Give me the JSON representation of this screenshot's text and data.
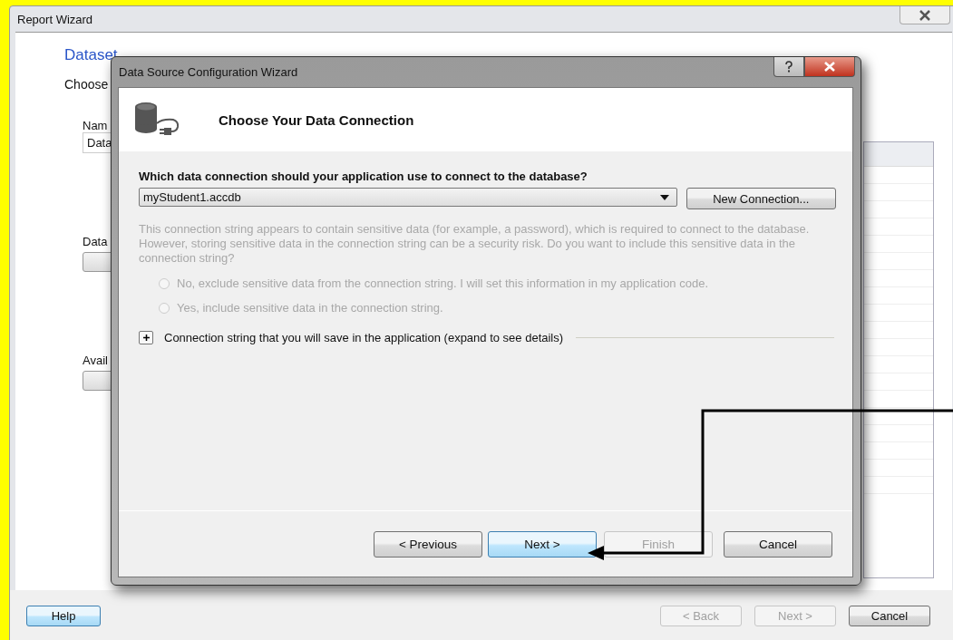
{
  "report_wizard": {
    "title": "Report Wizard",
    "heading": "Dataset",
    "labels": [
      {
        "kind": "text",
        "text": "Choose"
      },
      {
        "kind": "label",
        "text": "Nam"
      },
      {
        "kind": "field",
        "text": "Data"
      },
      {
        "kind": "label",
        "text": "Data"
      },
      {
        "kind": "button"
      },
      {
        "kind": "label",
        "text": "Avail"
      },
      {
        "kind": "button"
      }
    ],
    "footer_buttons": [
      {
        "label": "Help",
        "disabled": false,
        "focused": true
      },
      {
        "label": "< Back",
        "disabled": true,
        "focused": false
      },
      {
        "label": "Next >",
        "disabled": true,
        "focused": false
      },
      {
        "label": "Cancel",
        "disabled": false,
        "focused": false
      }
    ]
  },
  "dialog": {
    "title": "Data Source Configuration Wizard",
    "heading": "Choose Your Data Connection",
    "question": "Which data connection should your application use to connect to the database?",
    "connection": {
      "value": "myStudent1.accdb"
    },
    "new_connection_button": "New Connection...",
    "notice": {
      "text": "This connection string appears to contain sensitive data (for example, a password), which is required to connect to the database. However, storing sensitive data in the connection string can be a security risk. Do you want to include this sensitive data in the connection string?",
      "disabled": true
    },
    "options": [
      {
        "label": "No, exclude sensitive data from the connection string. I will set this information in my application code.",
        "selected": false,
        "disabled": true
      },
      {
        "label": "Yes, include sensitive data in the connection string.",
        "selected": false,
        "disabled": true
      }
    ],
    "expander": {
      "label": "Connection string that you will save in the application (expand to see details)",
      "expanded": false
    },
    "buttons": [
      {
        "label": "< Previous",
        "disabled": false,
        "focused": false
      },
      {
        "label": "Next >",
        "disabled": false,
        "focused": true
      },
      {
        "label": "Finish",
        "disabled": true,
        "focused": false
      },
      {
        "label": "Cancel",
        "disabled": false,
        "focused": false
      }
    ]
  }
}
